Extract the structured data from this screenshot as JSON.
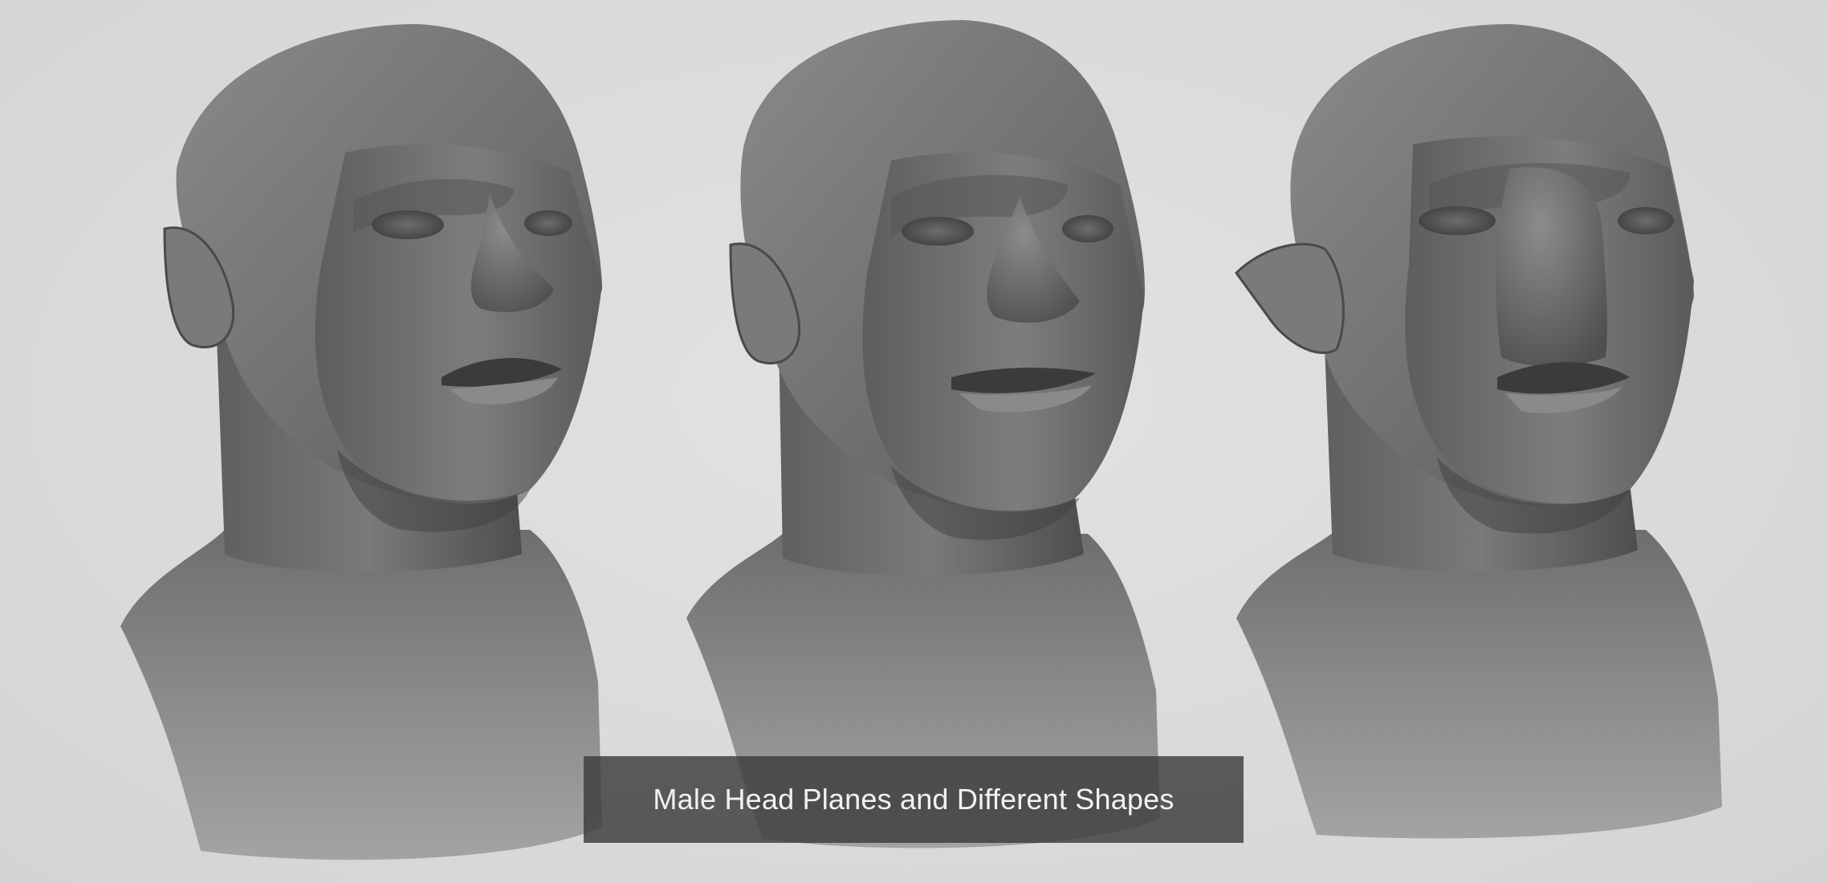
{
  "caption": {
    "text": "Male Head Planes and Different Shapes"
  },
  "scene": {
    "background_color": "#dcdcdc",
    "material_color": "#8a8a8a",
    "caption_bg_color": "#3c3c3c",
    "caption_text_color": "#f2f2f2",
    "busts": [
      {
        "name": "stylized-head-bust-left"
      },
      {
        "name": "stylized-head-bust-middle"
      },
      {
        "name": "creature-head-bust-right"
      }
    ]
  }
}
